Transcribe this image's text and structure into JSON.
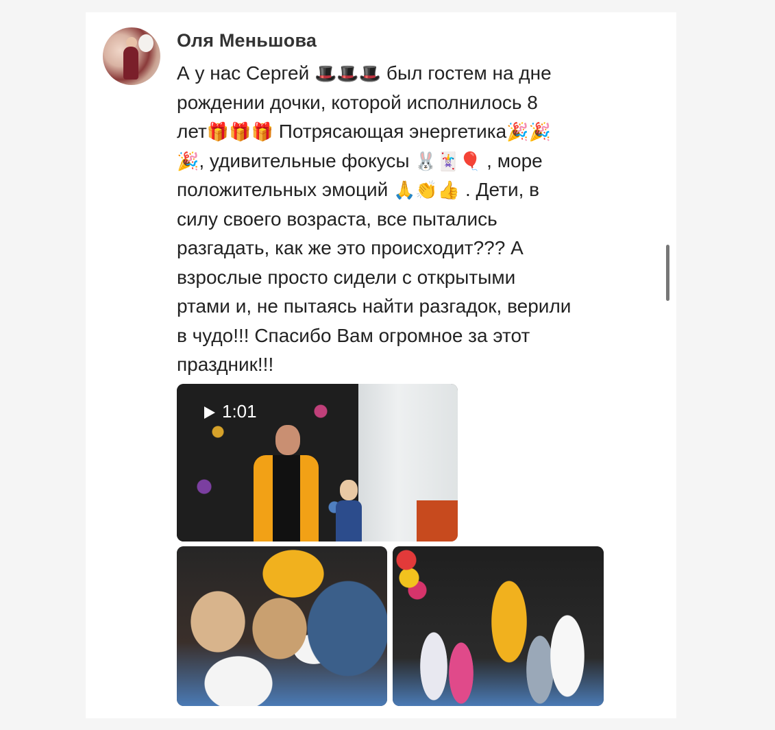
{
  "comment": {
    "author": "Оля Меньшова",
    "lines": [
      {
        "before": "А у нас Сергей ",
        "emoji": "🎩🎩🎩",
        "after": " был гостем на дне"
      },
      {
        "text": "рождении дочки, которой исполнилось 8"
      },
      {
        "before": "лет",
        "emoji": "🎁🎁🎁",
        "after": " Потрясающая энергетика",
        "emoji2": "🎉🎉"
      },
      {
        "emoji": "🎉",
        "after": ", удивительные фокусы ",
        "emoji2": "🐰🃏🎈",
        "after2": " , море"
      },
      {
        "before": "положительных эмоций ",
        "emoji": "🙏👏👍",
        "after": " . Дети, в"
      },
      {
        "text": "силу своего возраста, все пытались"
      },
      {
        "text": "разгадать, как же это происходит??? А"
      },
      {
        "text": "взрослые просто сидели с открытыми"
      },
      {
        "text": "ртами и, не пытаясь найти разгадок, верили"
      },
      {
        "text": "в чудо!!! Спасибо Вам огромное за этот"
      },
      {
        "text": "праздник!!!"
      }
    ]
  },
  "media": {
    "video_duration": "1:01",
    "play_icon": "play-icon"
  }
}
